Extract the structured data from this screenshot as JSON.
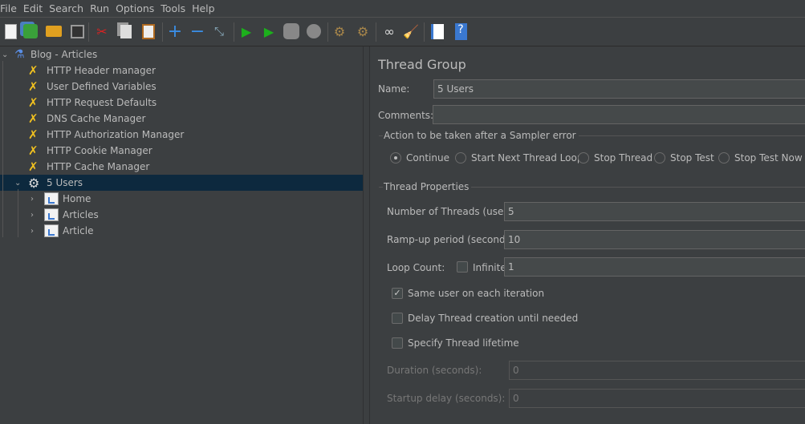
{
  "menu": [
    "File",
    "Edit",
    "Search",
    "Run",
    "Options",
    "Tools",
    "Help"
  ],
  "toolbar": [
    {
      "icon": "new-icon"
    },
    {
      "icon": "templates-icon"
    },
    {
      "icon": "open-icon"
    },
    {
      "icon": "save-icon"
    },
    {
      "icon": "cut-icon"
    },
    {
      "icon": "copy-icon"
    },
    {
      "icon": "paste-icon"
    },
    {
      "icon": "expand-icon"
    },
    {
      "icon": "collapse-icon"
    },
    {
      "icon": "toggle-icon"
    },
    {
      "icon": "start-icon"
    },
    {
      "icon": "start-no-pauses-icon"
    },
    {
      "icon": "stop-icon"
    },
    {
      "icon": "shutdown-icon"
    },
    {
      "icon": "clear-icon"
    },
    {
      "icon": "clear-all-icon"
    },
    {
      "icon": "search-icon"
    },
    {
      "icon": "reset-search-icon"
    },
    {
      "icon": "function-helper-icon"
    },
    {
      "icon": "help-icon"
    }
  ],
  "tree": {
    "root": "Blog - Articles",
    "config": [
      "HTTP Header manager",
      "User Defined Variables",
      "HTTP Request Defaults",
      "DNS Cache Manager",
      "HTTP Authorization Manager",
      "HTTP Cookie Manager",
      "HTTP Cache Manager"
    ],
    "thread_group": "5 Users",
    "controllers": [
      "Home",
      "Articles",
      "Article"
    ]
  },
  "panel": {
    "title": "Thread Group",
    "name_label": "Name:",
    "name_value": "5 Users",
    "comments_label": "Comments:",
    "comments_value": "",
    "error_section": "Action to be taken after a Sampler error",
    "error_options": [
      "Continue",
      "Start Next Thread Loop",
      "Stop Thread",
      "Stop Test",
      "Stop Test Now"
    ],
    "error_selected": "Continue",
    "props_section": "Thread Properties",
    "threads_label": "Number of Threads (users):",
    "threads_value": "5",
    "rampup_label": "Ramp-up period (seconds):",
    "rampup_value": "10",
    "loop_label": "Loop Count:",
    "infinite_label": "Infinite",
    "infinite_checked": false,
    "loop_value": "1",
    "same_user_label": "Same user on each iteration",
    "same_user_checked": true,
    "delay_label": "Delay Thread creation until needed",
    "delay_checked": false,
    "lifetime_label": "Specify Thread lifetime",
    "lifetime_checked": false,
    "duration_label": "Duration (seconds):",
    "duration_value": "0",
    "startup_label": "Startup delay (seconds):",
    "startup_value": "0"
  },
  "colors": {
    "background": "#3c3f41",
    "selection": "#0d293e",
    "input": "#45494a",
    "text": "#bbbbbb"
  }
}
